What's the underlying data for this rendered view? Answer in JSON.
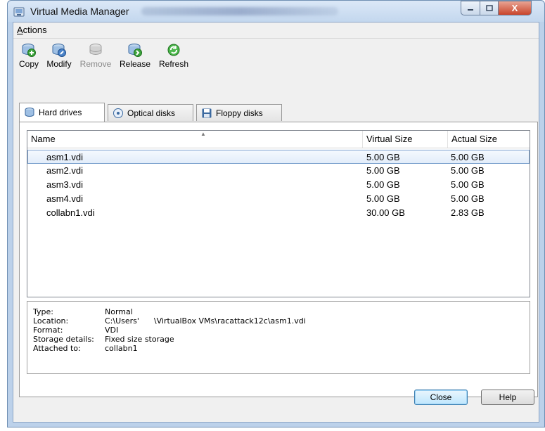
{
  "window": {
    "title": "Virtual Media Manager",
    "controls": {
      "minimize": "–",
      "maximize": "□",
      "close": "X"
    }
  },
  "menu": {
    "actions_label": "Actions",
    "actions_accel": "A",
    "actions_rest": "ctions"
  },
  "toolbar": {
    "items": [
      {
        "label": "Copy",
        "icon": "copy-disk-icon",
        "enabled": true
      },
      {
        "label": "Modify",
        "icon": "modify-disk-icon",
        "enabled": true
      },
      {
        "label": "Remove",
        "icon": "remove-disk-icon",
        "enabled": false
      },
      {
        "label": "Release",
        "icon": "release-disk-icon",
        "enabled": true
      },
      {
        "label": "Refresh",
        "icon": "refresh-icon",
        "enabled": true
      }
    ]
  },
  "tabs": [
    {
      "label": "Hard drives",
      "icon": "hard-drive-icon",
      "active": true
    },
    {
      "label": "Optical disks",
      "icon": "optical-disk-icon",
      "active": false
    },
    {
      "label": "Floppy disks",
      "icon": "floppy-disk-icon",
      "active": false
    }
  ],
  "table": {
    "columns": [
      "Name",
      "Virtual Size",
      "Actual Size"
    ],
    "rows": [
      {
        "name": "asm1.vdi",
        "virtual": "5.00 GB",
        "actual": "5.00 GB",
        "selected": true
      },
      {
        "name": "asm2.vdi",
        "virtual": "5.00 GB",
        "actual": "5.00 GB",
        "selected": false
      },
      {
        "name": "asm3.vdi",
        "virtual": "5.00 GB",
        "actual": "5.00 GB",
        "selected": false
      },
      {
        "name": "asm4.vdi",
        "virtual": "5.00 GB",
        "actual": "5.00 GB",
        "selected": false
      },
      {
        "name": "collabn1.vdi",
        "virtual": "30.00 GB",
        "actual": "2.83 GB",
        "selected": false
      }
    ]
  },
  "details": [
    {
      "label": "Type:",
      "value": "Normal"
    },
    {
      "label": "Location:",
      "value": "C:\\Users'      \\VirtualBox VMs\\racattack12c\\asm1.vdi"
    },
    {
      "label": "Format:",
      "value": "VDI"
    },
    {
      "label": "Storage details:",
      "value": "Fixed size storage"
    },
    {
      "label": "Attached to:",
      "value": "collabn1"
    }
  ],
  "buttons": {
    "close": "Close",
    "help": "Help"
  },
  "colors": {
    "titlebar": "#c3d7ee",
    "selection_border": "#7da2ce",
    "close_button": "#c9452b",
    "default_button": "#bee6fd"
  }
}
